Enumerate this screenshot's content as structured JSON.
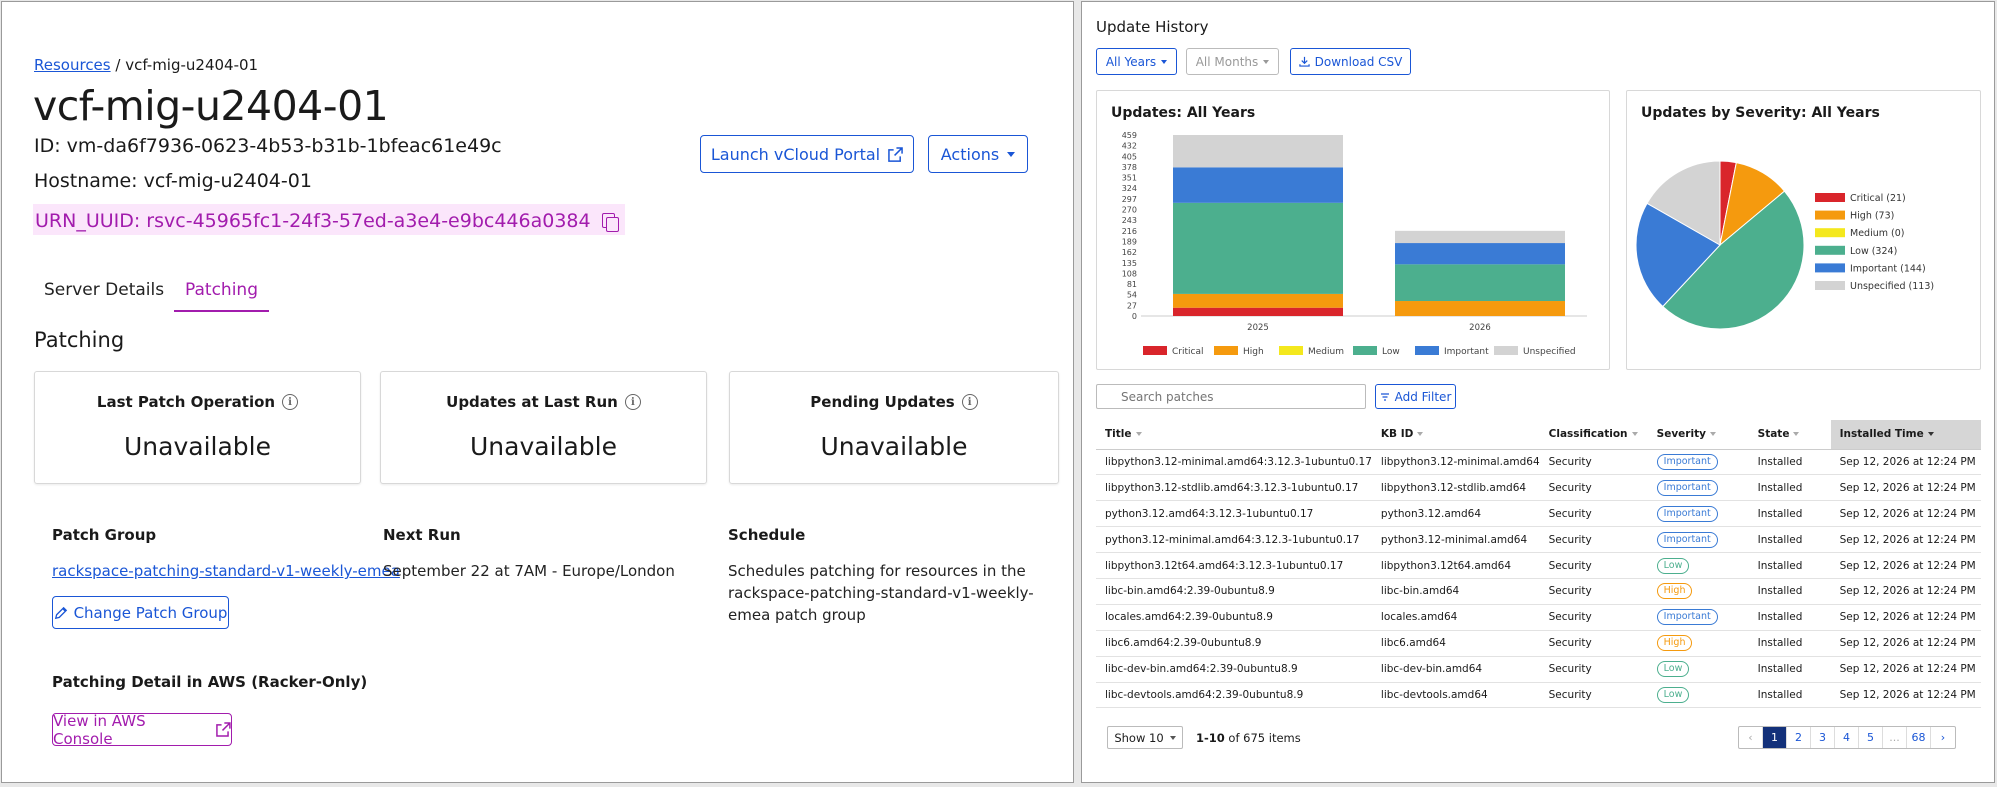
{
  "breadcrumb": {
    "link": "Resources",
    "separator": " / ",
    "current": "vcf-mig-u2404-01"
  },
  "resource": {
    "title": "vcf-mig-u2404-01",
    "id_line": "ID: vm-da6f7936-0623-4b53-b31b-1bfeac61e49c",
    "hostname_line": "Hostname: vcf-mig-u2404-01",
    "urn_line": "URN_UUID: rsvc-45965fc1-24f3-57ed-a3e4-e9bc446a0384"
  },
  "header_buttons": {
    "launch": "Launch vCloud Portal",
    "actions": "Actions"
  },
  "tabs": [
    {
      "label": "Server Details",
      "active": false
    },
    {
      "label": "Patching",
      "active": true
    }
  ],
  "patching": {
    "section_title": "Patching",
    "cards": [
      {
        "label": "Last Patch Operation",
        "value": "Unavailable"
      },
      {
        "label": "Updates at Last Run",
        "value": "Unavailable"
      },
      {
        "label": "Pending Updates",
        "value": "Unavailable"
      }
    ],
    "patch_group": {
      "label": "Patch Group",
      "value": "rackspace-patching-standard-v1-weekly-emea",
      "button": "Change Patch Group"
    },
    "next_run": {
      "label": "Next Run",
      "value": "September 22 at 7AM - Europe/London"
    },
    "schedule": {
      "label": "Schedule",
      "value": "Schedules patching for resources in the rackspace-patching-standard-v1-weekly-emea patch group"
    },
    "aws": {
      "label": "Patching Detail in AWS (Racker-Only)",
      "button": "View in AWS Console"
    }
  },
  "update_history": {
    "title": "Update History",
    "filters": {
      "years": "All Years",
      "months": "All Months",
      "download": "Download CSV"
    },
    "search_placeholder": "Search patches",
    "add_filter": "Add Filter",
    "columns": [
      "Title",
      "KB ID",
      "Classification",
      "Severity",
      "State",
      "Installed Time"
    ],
    "rows": [
      {
        "title": "libpython3.12-minimal.amd64:3.12.3-1ubuntu0.17",
        "kb": "libpython3.12-minimal.amd64",
        "classification": "Security",
        "severity": "Important",
        "state": "Installed",
        "time": "Sep 12, 2026 at 12:24 PM"
      },
      {
        "title": "libpython3.12-stdlib.amd64:3.12.3-1ubuntu0.17",
        "kb": "libpython3.12-stdlib.amd64",
        "classification": "Security",
        "severity": "Important",
        "state": "Installed",
        "time": "Sep 12, 2026 at 12:24 PM"
      },
      {
        "title": "python3.12.amd64:3.12.3-1ubuntu0.17",
        "kb": "python3.12.amd64",
        "classification": "Security",
        "severity": "Important",
        "state": "Installed",
        "time": "Sep 12, 2026 at 12:24 PM"
      },
      {
        "title": "python3.12-minimal.amd64:3.12.3-1ubuntu0.17",
        "kb": "python3.12-minimal.amd64",
        "classification": "Security",
        "severity": "Important",
        "state": "Installed",
        "time": "Sep 12, 2026 at 12:24 PM"
      },
      {
        "title": "libpython3.12t64.amd64:3.12.3-1ubuntu0.17",
        "kb": "libpython3.12t64.amd64",
        "classification": "Security",
        "severity": "Low",
        "state": "Installed",
        "time": "Sep 12, 2026 at 12:24 PM"
      },
      {
        "title": "libc-bin.amd64:2.39-0ubuntu8.9",
        "kb": "libc-bin.amd64",
        "classification": "Security",
        "severity": "High",
        "state": "Installed",
        "time": "Sep 12, 2026 at 12:24 PM"
      },
      {
        "title": "locales.amd64:2.39-0ubuntu8.9",
        "kb": "locales.amd64",
        "classification": "Security",
        "severity": "Important",
        "state": "Installed",
        "time": "Sep 12, 2026 at 12:24 PM"
      },
      {
        "title": "libc6.amd64:2.39-0ubuntu8.9",
        "kb": "libc6.amd64",
        "classification": "Security",
        "severity": "High",
        "state": "Installed",
        "time": "Sep 12, 2026 at 12:24 PM"
      },
      {
        "title": "libc-dev-bin.amd64:2.39-0ubuntu8.9",
        "kb": "libc-dev-bin.amd64",
        "classification": "Security",
        "severity": "Low",
        "state": "Installed",
        "time": "Sep 12, 2026 at 12:24 PM"
      },
      {
        "title": "libc-devtools.amd64:2.39-0ubuntu8.9",
        "kb": "libc-devtools.amd64",
        "classification": "Security",
        "severity": "Low",
        "state": "Installed",
        "time": "Sep 12, 2026 at 12:24 PM"
      }
    ],
    "pagination": {
      "show": "Show 10",
      "count_bold": "1-10",
      "count_rest": " of 675 items",
      "pages": [
        "1",
        "2",
        "3",
        "4",
        "5",
        "...",
        "68"
      ]
    }
  },
  "severity_colors": {
    "Critical": "#d9252b",
    "High": "#f59a0e",
    "Medium": "#f4e81d",
    "Low": "#4caf8e",
    "Important": "#3a7bd5",
    "Unspecified": "#d3d3d3"
  },
  "chart_data": [
    {
      "type": "bar",
      "stacked": true,
      "title": "Updates: All Years",
      "categories": [
        "2025",
        "2026"
      ],
      "y_ticks": [
        0,
        27,
        54,
        81,
        108,
        135,
        162,
        189,
        216,
        243,
        270,
        297,
        324,
        351,
        378,
        405,
        432,
        459
      ],
      "ylim": [
        0,
        459
      ],
      "legend": "bottom",
      "series": [
        {
          "name": "Critical",
          "values": [
            21,
            0
          ]
        },
        {
          "name": "High",
          "values": [
            35,
            38
          ]
        },
        {
          "name": "Medium",
          "values": [
            0,
            0
          ]
        },
        {
          "name": "Low",
          "values": [
            231,
            93
          ]
        },
        {
          "name": "Important",
          "values": [
            90,
            54
          ]
        },
        {
          "name": "Unspecified",
          "values": [
            82,
            31
          ]
        }
      ]
    },
    {
      "type": "pie",
      "title": "Updates by Severity: All Years",
      "legend": "right",
      "slices": [
        {
          "name": "Critical",
          "value": 21,
          "label": "Critical (21)"
        },
        {
          "name": "High",
          "value": 73,
          "label": "High (73)"
        },
        {
          "name": "Medium",
          "value": 0,
          "label": "Medium (0)"
        },
        {
          "name": "Low",
          "value": 324,
          "label": "Low (324)"
        },
        {
          "name": "Important",
          "value": 144,
          "label": "Important (144)"
        },
        {
          "name": "Unspecified",
          "value": 113,
          "label": "Unspecified (113)"
        }
      ]
    }
  ]
}
